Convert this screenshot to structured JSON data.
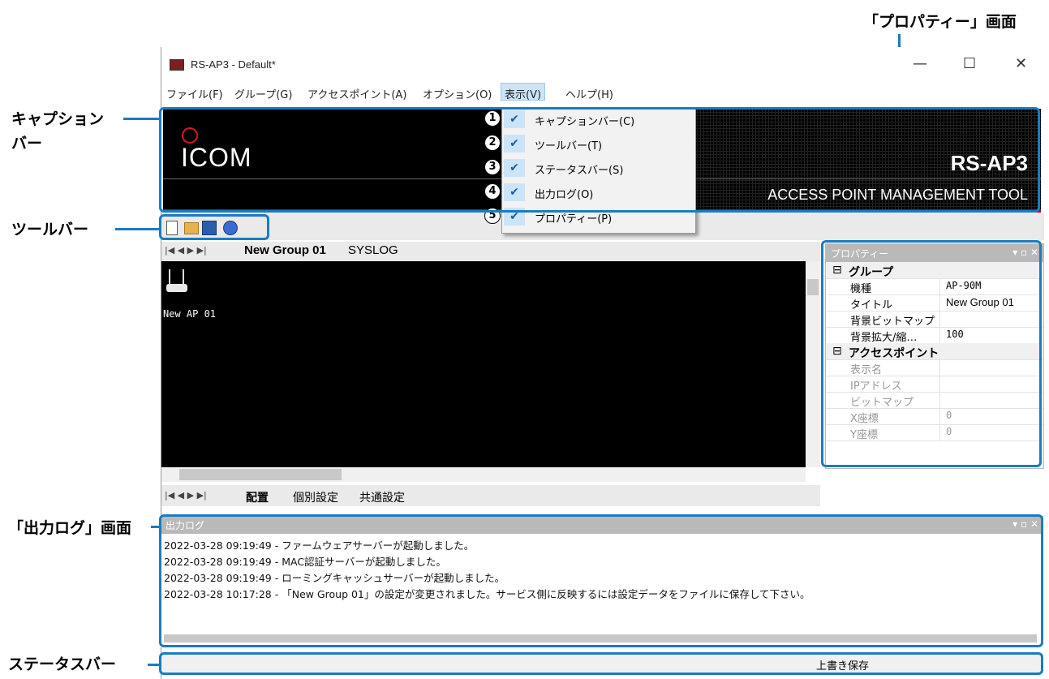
{
  "annotations": {
    "property_screen": "「プロパティー」画面",
    "caption_bar_line1": "キャプション",
    "caption_bar_line2": "バー",
    "toolbar": "ツールバー",
    "output_log_screen": "「出力ログ」画面",
    "status_bar": "ステータスバー",
    "highlight_color": "#1a7cc0"
  },
  "window": {
    "title": "RS-AP3 - Default*",
    "minimize": "—",
    "maximize": "☐",
    "close": "✕"
  },
  "menubar": {
    "items": [
      {
        "label": "ファイル(F)"
      },
      {
        "label": "グループ(G)"
      },
      {
        "label": "アクセスポイント(A)"
      },
      {
        "label": "オプション(O)"
      },
      {
        "label": "表示(V)"
      },
      {
        "label": "ヘルプ(H)"
      }
    ]
  },
  "caption": {
    "logo": "ICOM",
    "product": "RS-AP3",
    "subtitle": "ACCESS POINT MANAGEMENT TOOL"
  },
  "view_menu": {
    "items": [
      {
        "num": "1",
        "label": "キャプションバー(C)",
        "checked": true
      },
      {
        "num": "2",
        "label": "ツールバー(T)",
        "checked": true
      },
      {
        "num": "3",
        "label": "ステータスバー(S)",
        "checked": true
      },
      {
        "num": "4",
        "label": "出力ログ(O)",
        "checked": true
      },
      {
        "num": "5",
        "label": "プロパティー(P)",
        "checked": true
      }
    ],
    "check_glyph": "✔"
  },
  "tabs": {
    "nav": "|◀ ◀ ▶ ▶|",
    "top": [
      "New Group 01",
      "SYSLOG"
    ],
    "bottom": [
      "配置",
      "個別設定",
      "共通設定"
    ]
  },
  "canvas": {
    "ap_name": "New AP 01"
  },
  "properties": {
    "header": "プロパティー",
    "group_category": "グループ",
    "group_rows": [
      {
        "key": "機種",
        "value": "AP-90M"
      },
      {
        "key": "タイトル",
        "value": "New Group 01"
      },
      {
        "key": "背景ビットマップ",
        "value": ""
      },
      {
        "key": "背景拡大/縮…",
        "value": "100"
      }
    ],
    "ap_category": "アクセスポイント",
    "ap_rows": [
      {
        "key": "表示名",
        "value": ""
      },
      {
        "key": "IPアドレス",
        "value": ""
      },
      {
        "key": "ビットマップ",
        "value": ""
      },
      {
        "key": "X座標",
        "value": "0"
      },
      {
        "key": "Y座標",
        "value": "0"
      }
    ]
  },
  "output_log": {
    "header": "出力ログ",
    "lines": [
      "2022-03-28 09:19:49 - ファームウェアサーバーが起動しました。",
      "2022-03-28 09:19:49 - MAC認証サーバーが起動しました。",
      "2022-03-28 09:19:49 - ローミングキャッシュサーバーが起動しました。",
      "2022-03-28 10:17:28 - 「New Group 01」の設定が変更されました。サービス側に反映するには設定データをファイルに保存して下さい。"
    ]
  },
  "statusbar": {
    "text": "上書き保存"
  }
}
